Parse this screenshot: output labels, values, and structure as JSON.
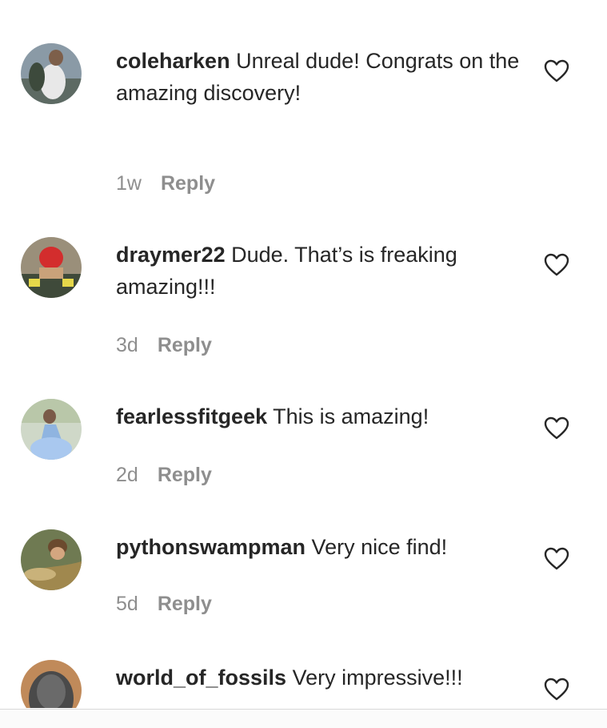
{
  "comments": [
    {
      "username": "coleharken",
      "text": "Unreal dude! Congrats on the amazing discovery!",
      "time": "1w",
      "reply": "Reply",
      "like_icon": "heart-outline-icon"
    },
    {
      "username": "draymer22",
      "text": "Dude. That’s is freaking amazing!!!",
      "time": "3d",
      "reply": "Reply",
      "like_icon": "heart-outline-icon"
    },
    {
      "username": "fearlessfitgeek",
      "text": "This is amazing!",
      "time": "2d",
      "reply": "Reply",
      "like_icon": "heart-outline-icon"
    },
    {
      "username": "pythonswampman",
      "text": "Very nice find!",
      "time": "5d",
      "reply": "Reply",
      "like_icon": "heart-outline-icon"
    },
    {
      "username": "world_of_fossils",
      "text": "Very impressive!!!",
      "like_icon": "heart-outline-icon"
    }
  ],
  "colors": {
    "text": "#262626",
    "secondary": "#8e8e8e",
    "divider": "#d9d9d9"
  }
}
